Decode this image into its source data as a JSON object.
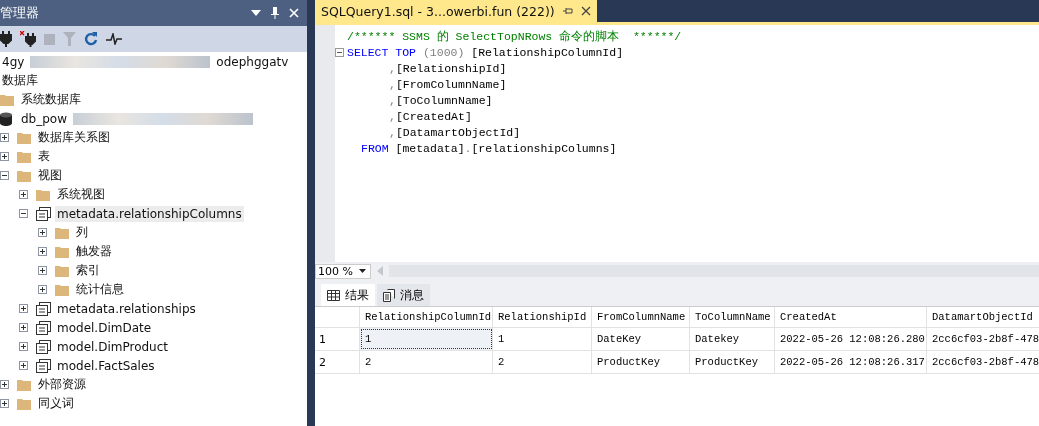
{
  "explorer": {
    "title": "管理器",
    "toolbar": [
      {
        "kind": "connect",
        "disabled": false
      },
      {
        "kind": "disconnect",
        "disabled": false
      },
      {
        "kind": "stop",
        "disabled": true
      },
      {
        "kind": "filter",
        "disabled": true
      },
      {
        "kind": "refresh",
        "disabled": false
      },
      {
        "kind": "activity",
        "disabled": false
      }
    ],
    "tree": [
      {
        "label": "4gy",
        "label_end": "odephggatv",
        "blurred": true,
        "selected": false,
        "children": [
          {
            "label": "数据库",
            "selected": false,
            "children": [
              {
                "kind": "folder",
                "label": "系统数据库",
                "selected": false
              },
              {
                "kind": "database",
                "label": "db_pow",
                "blurred": true,
                "selected": false,
                "children": [
                  {
                    "kind": "folder",
                    "label": "数据库关系图",
                    "expanded": false,
                    "selected": false
                  },
                  {
                    "kind": "folder",
                    "label": "表",
                    "expanded": false,
                    "selected": false
                  },
                  {
                    "kind": "folder",
                    "label": "视图",
                    "expanded": true,
                    "selected": false,
                    "children": [
                      {
                        "kind": "folder",
                        "label": "系统视图",
                        "expanded": false,
                        "selected": false
                      },
                      {
                        "kind": "view",
                        "label": "metadata.relationshipColumns",
                        "expanded": true,
                        "selected": true,
                        "children": [
                          {
                            "kind": "folder",
                            "label": "列",
                            "expanded": false,
                            "selected": false
                          },
                          {
                            "kind": "folder",
                            "label": "触发器",
                            "expanded": false,
                            "selected": false
                          },
                          {
                            "kind": "folder",
                            "label": "索引",
                            "expanded": false,
                            "selected": false
                          },
                          {
                            "kind": "folder",
                            "label": "统计信息",
                            "expanded": false,
                            "selected": false
                          }
                        ]
                      },
                      {
                        "kind": "view",
                        "label": "metadata.relationships",
                        "expanded": false,
                        "selected": false
                      },
                      {
                        "kind": "view",
                        "label": "model.DimDate",
                        "expanded": false,
                        "selected": false
                      },
                      {
                        "kind": "view",
                        "label": "model.DimProduct",
                        "expanded": false,
                        "selected": false
                      },
                      {
                        "kind": "view",
                        "label": "model.FactSales",
                        "expanded": false,
                        "selected": false
                      }
                    ]
                  },
                  {
                    "kind": "folder",
                    "label": "外部资源",
                    "expanded": false,
                    "selected": false
                  },
                  {
                    "kind": "folder",
                    "label": "同义词",
                    "expanded": false,
                    "selected": false
                  }
                ]
              }
            ]
          }
        ]
      }
    ]
  },
  "editor": {
    "tab": {
      "title": "SQLQuery1.sql - 3...owerbi.fun (222))",
      "selected": true
    },
    "lines": [
      {
        "kind": "comment",
        "tokens": [
          {
            "kind": "comment",
            "text": "/****** SSMS 的 SelectTopNRows 命令的脚本  ******/"
          }
        ]
      },
      {
        "kind": "statement",
        "tokens": [
          {
            "kind": "keyword",
            "text": "SELECT TOP "
          },
          {
            "kind": "punct",
            "text": "(1000) "
          },
          {
            "kind": "plain",
            "text": "[RelationshipColumnId]"
          }
        ]
      },
      {
        "kind": "continuation",
        "tokens": [
          {
            "kind": "punct",
            "text": ","
          },
          {
            "kind": "plain",
            "text": "[RelationshipId]"
          }
        ]
      },
      {
        "kind": "continuation",
        "tokens": [
          {
            "kind": "punct",
            "text": ","
          },
          {
            "kind": "plain",
            "text": "[FromColumnName]"
          }
        ]
      },
      {
        "kind": "continuation",
        "tokens": [
          {
            "kind": "punct",
            "text": ","
          },
          {
            "kind": "plain",
            "text": "[ToColumnName]"
          }
        ]
      },
      {
        "kind": "continuation",
        "tokens": [
          {
            "kind": "punct",
            "text": ","
          },
          {
            "kind": "plain",
            "text": "[CreatedAt]"
          }
        ]
      },
      {
        "kind": "continuation",
        "tokens": [
          {
            "kind": "punct",
            "text": ","
          },
          {
            "kind": "plain",
            "text": "[DatamartObjectId]"
          }
        ]
      },
      {
        "kind": "clause",
        "tokens": [
          {
            "kind": "keyword",
            "text": "FROM "
          },
          {
            "kind": "plain",
            "text": "[metadata]"
          },
          {
            "kind": "punct",
            "text": "."
          },
          {
            "kind": "plain",
            "text": "[relationshipColumns]"
          }
        ]
      }
    ],
    "zoom": "100 %"
  },
  "results": {
    "tabs": [
      {
        "kind": "grid",
        "label": "结果",
        "selected": true
      },
      {
        "kind": "messages",
        "label": "消息",
        "selected": false
      }
    ],
    "columns": [
      "RelationshipColumnId",
      "RelationshipId",
      "FromColumnName",
      "ToColumnName",
      "CreatedAt",
      "DatamartObjectId"
    ],
    "rows": [
      {
        "number": "1",
        "focused": true,
        "cells": [
          "1",
          "1",
          "DateKey",
          "Datekey",
          "2022-05-26 12:08:26.280",
          "2cc6cf03-2b8f-478"
        ]
      },
      {
        "number": "2",
        "focused": false,
        "cells": [
          "2",
          "2",
          "ProductKey",
          "ProductKey",
          "2022-05-26 12:08:26.317",
          "2cc6cf03-2b8f-478"
        ]
      }
    ]
  }
}
